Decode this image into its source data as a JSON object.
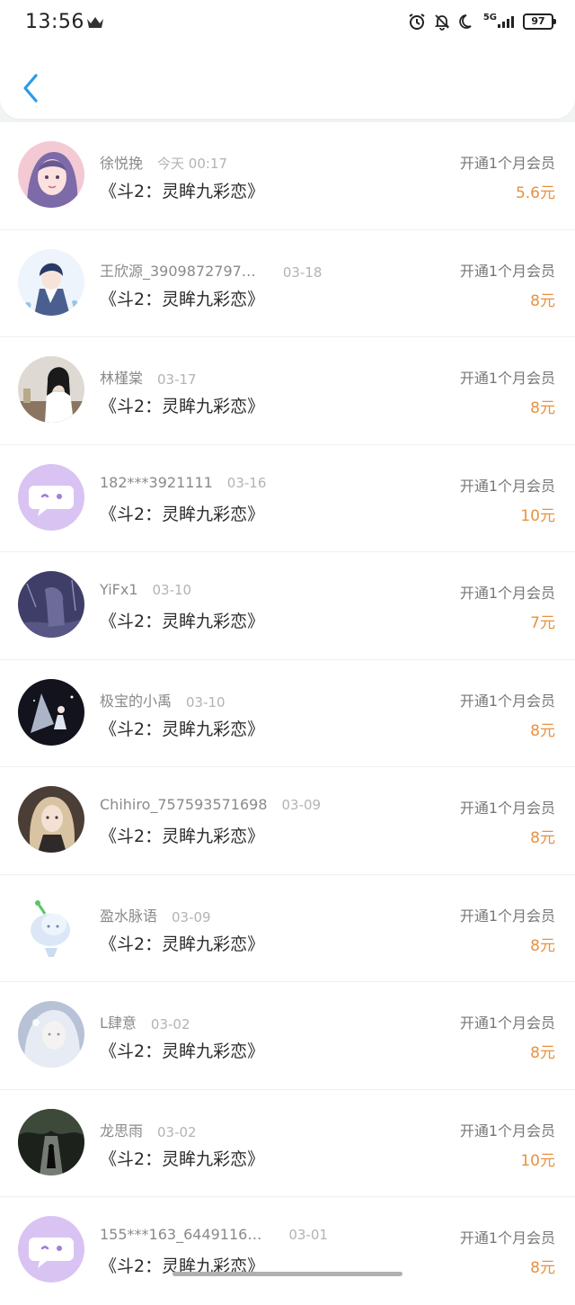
{
  "status_bar": {
    "time": "13:56",
    "network": "5G",
    "battery": "97"
  },
  "header": {
    "back_icon": "chevron-left-icon"
  },
  "colors": {
    "accent": "#2b9be8",
    "price": "#e8913f"
  },
  "records": [
    {
      "name": "徐悦挽",
      "time": "今天 00:17",
      "book": "《斗2：灵眸九彩恋》",
      "action": "开通1个月会员",
      "price": "5.6元"
    },
    {
      "name": "王欣源_3909872797…",
      "time": "03-18",
      "book": "《斗2：灵眸九彩恋》",
      "action": "开通1个月会员",
      "price": "8元"
    },
    {
      "name": "林槿棠",
      "time": "03-17",
      "book": "《斗2：灵眸九彩恋》",
      "action": "开通1个月会员",
      "price": "8元"
    },
    {
      "name": "182***3921111",
      "time": "03-16",
      "book": "《斗2：灵眸九彩恋》",
      "action": "开通1个月会员",
      "price": "10元"
    },
    {
      "name": "YiFx1",
      "time": "03-10",
      "book": "《斗2：灵眸九彩恋》",
      "action": "开通1个月会员",
      "price": "7元"
    },
    {
      "name": "极宝的小禹",
      "time": "03-10",
      "book": "《斗2：灵眸九彩恋》",
      "action": "开通1个月会员",
      "price": "8元"
    },
    {
      "name": "Chihiro_757593571698",
      "time": "03-09",
      "book": "《斗2：灵眸九彩恋》",
      "action": "开通1个月会员",
      "price": "8元"
    },
    {
      "name": "盈水脉语",
      "time": "03-09",
      "book": "《斗2：灵眸九彩恋》",
      "action": "开通1个月会员",
      "price": "8元"
    },
    {
      "name": "L肆意",
      "time": "03-02",
      "book": "《斗2：灵眸九彩恋》",
      "action": "开通1个月会员",
      "price": "8元"
    },
    {
      "name": "龙思雨",
      "time": "03-02",
      "book": "《斗2：灵眸九彩恋》",
      "action": "开通1个月会员",
      "price": "10元"
    },
    {
      "name": "155***163_6449116…",
      "time": "03-01",
      "book": "《斗2：灵眸九彩恋》",
      "action": "开通1个月会员",
      "price": "8元"
    }
  ]
}
